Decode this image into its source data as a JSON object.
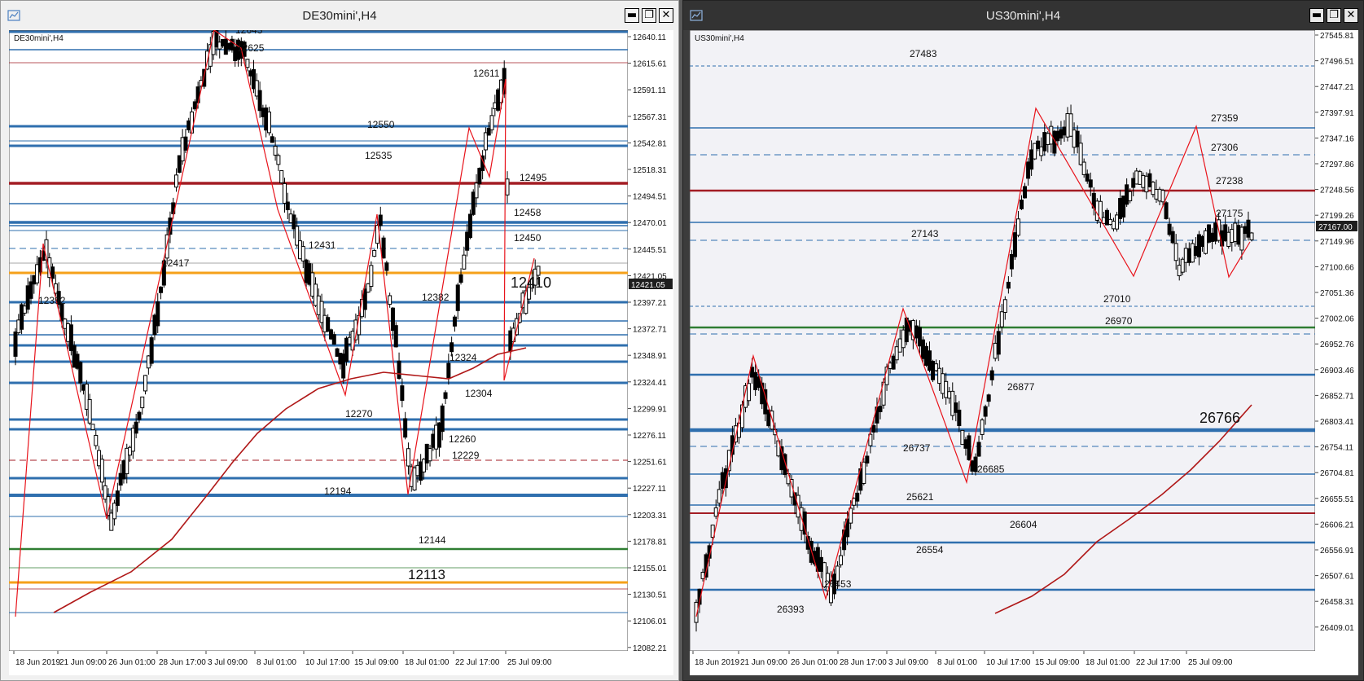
{
  "left": {
    "title": "DE30mini',H4",
    "corner_label": "DE30mini',H4",
    "controls": {
      "minimize": "▬",
      "restore": "❐",
      "close": "✕"
    },
    "price_axis": [
      "12640.11",
      "12615.61",
      "12591.11",
      "12567.31",
      "12542.81",
      "12518.31",
      "12494.51",
      "12470.01",
      "12445.51",
      "12421.05",
      "12397.21",
      "12372.71",
      "12348.91",
      "12324.41",
      "12299.91",
      "12276.11",
      "12251.61",
      "12227.11",
      "12203.31",
      "12178.81",
      "12155.01",
      "12130.51",
      "12106.01",
      "12082.21"
    ],
    "current_price": "12421.05",
    "time_axis": [
      "18 Jun 2019",
      "21 Jun 09:00",
      "26 Jun 01:00",
      "28 Jun 17:00",
      "3 Jul 09:00",
      "8 Jul 01:00",
      "10 Jul 17:00",
      "15 Jul 09:00",
      "18 Jul 01:00",
      "22 Jul 17:00",
      "25 Jul 09:00"
    ],
    "level_labels": [
      "12643",
      "12625",
      "12611",
      "12550",
      "12535",
      "12495",
      "12458",
      "12450",
      "12431",
      "12417",
      "12410",
      "12392",
      "12382",
      "12324",
      "12304",
      "12270",
      "12260",
      "12229",
      "12194",
      "12144",
      "12113"
    ],
    "colors": {
      "background": "#ffffff",
      "level": "#2f6fae",
      "resistance": "#a31d24",
      "support": "#2f7d32",
      "pivot": "#f5a11a",
      "zigzag": "#e8131b",
      "ma": "#b01818",
      "candle": "#000000"
    }
  },
  "right": {
    "title": "US30mini',H4",
    "corner_label": "US30mini',H4",
    "controls": {
      "minimize": "▬",
      "restore": "❐",
      "close": "✕"
    },
    "price_axis": [
      "27545.81",
      "27496.51",
      "27447.21",
      "27397.91",
      "27347.16",
      "27297.86",
      "27248.56",
      "27199.26",
      "27149.96",
      "27100.66",
      "27051.36",
      "27002.06",
      "26952.76",
      "26903.46",
      "26852.71",
      "26803.41",
      "26754.11",
      "26704.81",
      "26655.51",
      "26606.21",
      "26556.91",
      "26507.61",
      "26458.31",
      "26409.01"
    ],
    "current_price": "27167.00",
    "time_axis": [
      "18 Jun 2019",
      "21 Jun 09:00",
      "26 Jun 01:00",
      "28 Jun 17:00",
      "3 Jul 09:00",
      "8 Jul 01:00",
      "10 Jul 17:00",
      "15 Jul 09:00",
      "18 Jul 01:00",
      "22 Jul 17:00",
      "25 Jul 09:00"
    ],
    "level_labels": [
      "27483",
      "27359",
      "27306",
      "27238",
      "27175",
      "27143",
      "27010",
      "26970",
      "26877",
      "26766",
      "26737",
      "26685",
      "25621",
      "26604",
      "26554",
      "26453",
      "26393"
    ],
    "colors": {
      "background": "#f2f2f6",
      "level": "#2f6fae",
      "resistance": "#a31d24",
      "support": "#2f7d32",
      "zigzag": "#e8131b",
      "ma": "#b01818",
      "candle": "#000000"
    }
  }
}
